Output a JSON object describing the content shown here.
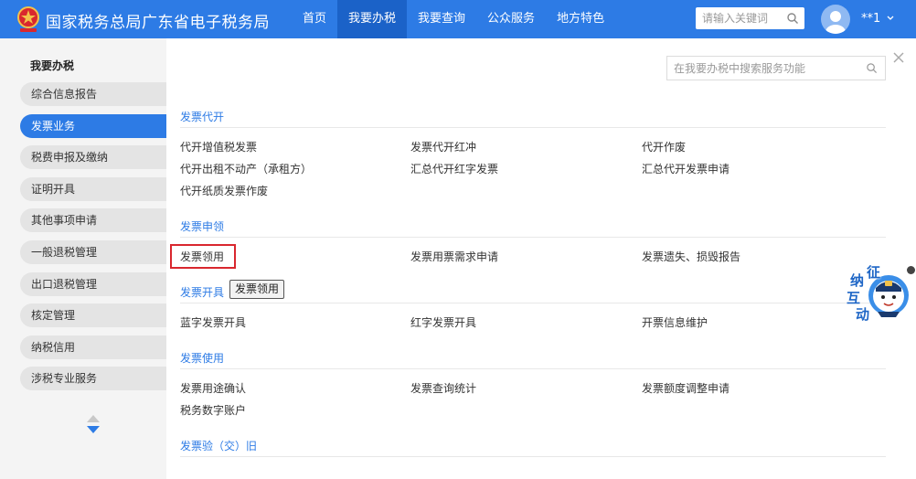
{
  "header": {
    "site_title": "国家税务总局广东省电子税务局",
    "nav": [
      "首页",
      "我要办税",
      "我要查询",
      "公众服务",
      "地方特色"
    ],
    "active_nav": "我要办税",
    "search_placeholder": "请输入关键词",
    "user_name": "**1",
    "accent_color": "#2d7be5"
  },
  "sidebar": {
    "title": "我要办税",
    "items": [
      {
        "label": "综合信息报告"
      },
      {
        "label": "发票业务"
      },
      {
        "label": "税费申报及缴纳"
      },
      {
        "label": "证明开具"
      },
      {
        "label": "其他事项申请"
      },
      {
        "label": "一般退税管理"
      },
      {
        "label": "出口退税管理"
      },
      {
        "label": "核定管理"
      },
      {
        "label": "纳税信用"
      },
      {
        "label": "涉税专业服务"
      }
    ],
    "active_item": "发票业务"
  },
  "main": {
    "search_placeholder": "在我要办税中搜索服务功能",
    "sections": [
      {
        "title": "发票代开",
        "items": [
          "代开增值税发票",
          "发票代开红冲",
          "代开作废",
          "代开出租不动产（承租方）",
          "汇总代开红字发票",
          "汇总代开发票申请",
          "代开纸质发票作废"
        ]
      },
      {
        "title": "发票申领",
        "items": [
          "发票领用",
          "发票用票需求申请",
          "发票遗失、损毁报告"
        ]
      },
      {
        "title": "发票开具",
        "items": [
          "蓝字发票开具",
          "红字发票开具",
          "开票信息维护"
        ]
      },
      {
        "title": "发票使用",
        "items": [
          "发票用途确认",
          "发票查询统计",
          "发票额度调整申请",
          "税务数字账户"
        ]
      },
      {
        "title": "发票验（交）旧",
        "items": []
      }
    ],
    "highlighted_item": "发票领用",
    "tooltip": "发票领用",
    "highlight_color": "#d9272e"
  },
  "assistant": {
    "chars": [
      "征",
      "纳",
      "互",
      "动"
    ]
  }
}
